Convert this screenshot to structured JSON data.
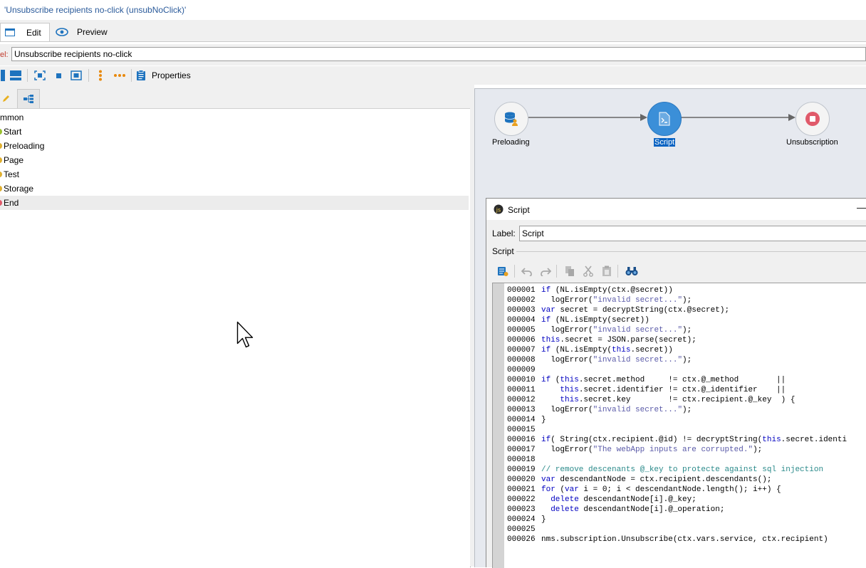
{
  "window": {
    "title": "'Unsubscribe recipients no-click (unsubNoClick)'"
  },
  "tabs": [
    {
      "label": "Edit"
    },
    {
      "label": "Preview"
    }
  ],
  "label_row": {
    "label": "el:",
    "value": "Unsubscribe recipients no-click"
  },
  "toolbar": {
    "properties_label": "Properties"
  },
  "tree": {
    "items": [
      {
        "label": "mmon"
      },
      {
        "label": "Start"
      },
      {
        "label": "Preloading"
      },
      {
        "label": "Page"
      },
      {
        "label": "Test"
      },
      {
        "label": "Storage"
      },
      {
        "label": "End"
      }
    ]
  },
  "diagram": {
    "nodes": [
      {
        "label": "Preloading",
        "icon": "database-user-icon"
      },
      {
        "label": "Script",
        "icon": "script-icon"
      },
      {
        "label": "Unsubscription",
        "icon": "stop-icon"
      }
    ]
  },
  "dialog": {
    "title": "Script",
    "minimize": "—",
    "label_caption": "Label:",
    "label_value": "Script",
    "group_caption": "Script",
    "code_lines": [
      {
        "n": "000001",
        "t": "if (NL.isEmpty(ctx.@secret))"
      },
      {
        "n": "000002",
        "t": "  logError(\"invalid secret...\");"
      },
      {
        "n": "000003",
        "t": "var secret = decryptString(ctx.@secret);"
      },
      {
        "n": "000004",
        "t": "if (NL.isEmpty(secret))"
      },
      {
        "n": "000005",
        "t": "  logError(\"invalid secret...\");"
      },
      {
        "n": "000006",
        "t": "this.secret = JSON.parse(secret);"
      },
      {
        "n": "000007",
        "t": "if (NL.isEmpty(this.secret))"
      },
      {
        "n": "000008",
        "t": "  logError(\"invalid secret...\");"
      },
      {
        "n": "000009",
        "t": ""
      },
      {
        "n": "000010",
        "t": "if (this.secret.method     != ctx.@_method        ||"
      },
      {
        "n": "000011",
        "t": "    this.secret.identifier != ctx.@_identifier    ||"
      },
      {
        "n": "000012",
        "t": "    this.secret.key        != ctx.recipient.@_key  ) {"
      },
      {
        "n": "000013",
        "t": "  logError(\"invalid secret...\");"
      },
      {
        "n": "000014",
        "t": "}"
      },
      {
        "n": "000015",
        "t": ""
      },
      {
        "n": "000016",
        "t": "if( String(ctx.recipient.@id) != decryptString(this.secret.identi"
      },
      {
        "n": "000017",
        "t": "  logError(\"The webApp inputs are corrupted.\");"
      },
      {
        "n": "000018",
        "t": ""
      },
      {
        "n": "000019",
        "t": "// remove descenants @_key to protecte against sql injection"
      },
      {
        "n": "000020",
        "t": "var descendantNode = ctx.recipient.descendants();"
      },
      {
        "n": "000021",
        "t": "for (var i = 0; i < descendantNode.length(); i++) {"
      },
      {
        "n": "000022",
        "t": "  delete descendantNode[i].@_key;"
      },
      {
        "n": "000023",
        "t": "  delete descendantNode[i].@_operation;"
      },
      {
        "n": "000024",
        "t": "}"
      },
      {
        "n": "000025",
        "t": ""
      },
      {
        "n": "000026",
        "t": "nms.subscription.Unsubscribe(ctx.vars.service, ctx.recipient)"
      }
    ]
  },
  "colors": {
    "accent": "#1e73be",
    "selection": "#0a63c2",
    "stop": "#e05a6a"
  }
}
